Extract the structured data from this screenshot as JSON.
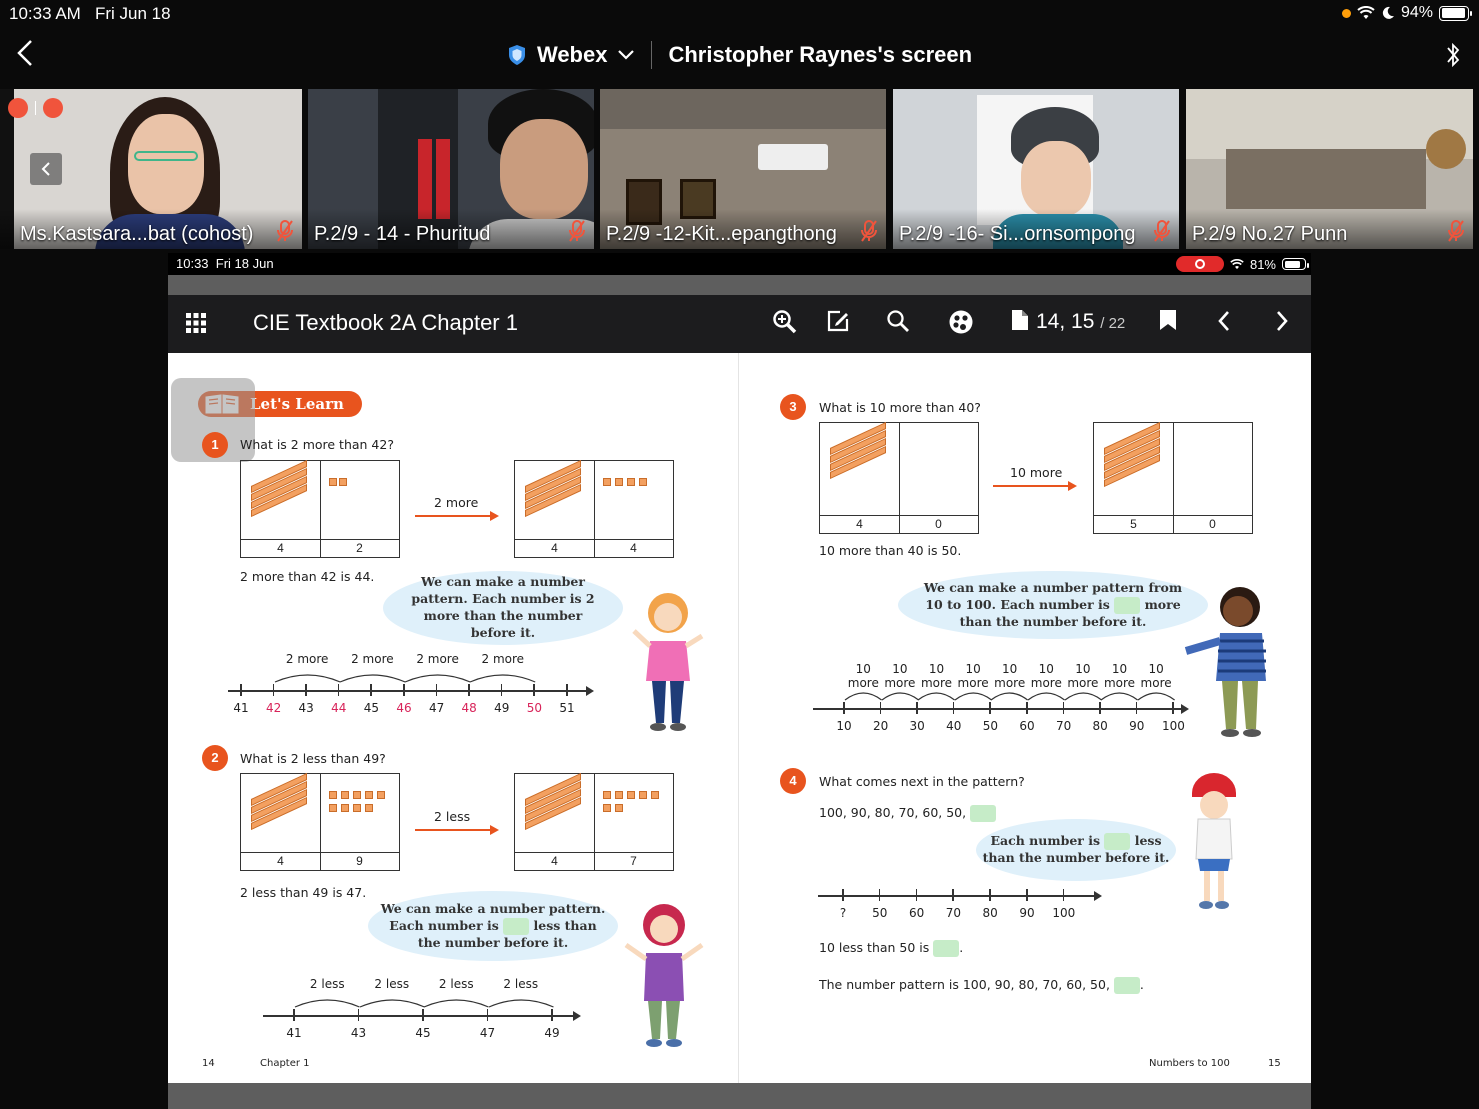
{
  "status_bar": {
    "time": "10:33 AM",
    "date": "Fri Jun 18",
    "battery": "94%",
    "battery_level": 0.94
  },
  "header": {
    "app": "Webex",
    "title": "Christopher Raynes's screen"
  },
  "participants": [
    {
      "name": "Ms.Kastsara...bat (cohost)"
    },
    {
      "name": "P.2/9 - 14 - Phuritud"
    },
    {
      "name": "P.2/9 -12-Kit...epangthong"
    },
    {
      "name": "P.2/9 -16- Si...ornsompong"
    },
    {
      "name": "P.2/9 No.27 Punn"
    }
  ],
  "shared": {
    "ipad_time": "10:33",
    "ipad_date": "Fri 18 Jun",
    "battery": "81%",
    "battery_level": 0.81,
    "doc_title": "CIE Textbook 2A Chapter 1",
    "page_current": "14, 15",
    "page_total": "/ 22"
  },
  "textbook": {
    "lets_learn": "Let's Learn",
    "q1": {
      "number": "1",
      "question": "What is 2 more than 42?",
      "arrow": "2 more",
      "left_labels": [
        "4",
        "2"
      ],
      "right_labels": [
        "4",
        "4"
      ],
      "answer": "2 more than 42 is 44.",
      "bubble": "We can make a number pattern. Each number is 2 more than the number before it.",
      "hops": [
        "2 more",
        "2 more",
        "2 more",
        "2 more"
      ],
      "ticks": [
        "41",
        "42",
        "43",
        "44",
        "45",
        "46",
        "47",
        "48",
        "49",
        "50",
        "51"
      ]
    },
    "q2": {
      "number": "2",
      "question": "What is 2 less than 49?",
      "arrow": "2 less",
      "left_labels": [
        "4",
        "9"
      ],
      "right_labels": [
        "4",
        "7"
      ],
      "answer": "2 less than 49 is 47.",
      "bubble_a": "We can make a number pattern.",
      "bubble_b": "Each number is",
      "bubble_c": "less than",
      "bubble_d": "the number before it.",
      "hops": [
        "2 less",
        "2 less",
        "2 less",
        "2 less"
      ],
      "ticks": [
        "41",
        "43",
        "45",
        "47",
        "49"
      ]
    },
    "q3": {
      "number": "3",
      "question": "What is 10 more than 40?",
      "arrow": "10 more",
      "left_labels": [
        "4",
        "0"
      ],
      "right_labels": [
        "5",
        "0"
      ],
      "answer": "10 more than 40 is 50.",
      "bubble_a": "We can make a number pattern from",
      "bubble_b": "10 to 100. Each number is",
      "bubble_c": "more",
      "bubble_d": "than the number before it.",
      "hop_num": "10",
      "hop_word": "more",
      "ticks": [
        "10",
        "20",
        "30",
        "40",
        "50",
        "60",
        "70",
        "80",
        "90",
        "100"
      ]
    },
    "q4": {
      "number": "4",
      "question": "What comes next in the pattern?",
      "sequence": "100, 90, 80, 70, 60, 50,",
      "bubble_a": "Each number is",
      "bubble_b": "less",
      "bubble_c": "than the number before it.",
      "ticks": [
        "?",
        "50",
        "60",
        "70",
        "80",
        "90",
        "100"
      ],
      "fill1": "10 less than 50 is",
      "fill2": "The number pattern is 100, 90, 80, 70, 60, 50,",
      "dot": "."
    },
    "footer_left_page": "14",
    "footer_left_text": "Chapter 1",
    "footer_right_text": "Numbers to 100",
    "footer_right_page": "15"
  },
  "colors": {
    "accent": "#e8541e",
    "bubble": "#dff0fa",
    "blank": "#c6ecc8",
    "highlight_number": "#d8245a"
  }
}
